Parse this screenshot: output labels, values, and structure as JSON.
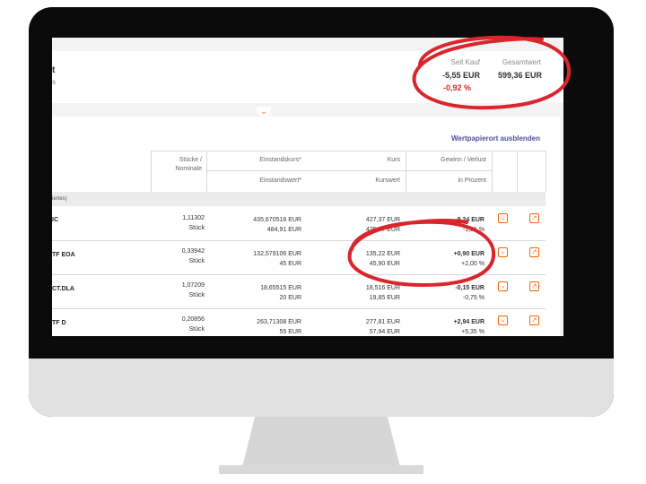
{
  "summary": {
    "title": "t",
    "subtitle": "s",
    "seit_kauf_label": "Seit Kauf",
    "seit_kauf_eur": "-5,55 EUR",
    "seit_kauf_pct": "-0,92 %",
    "gesamtwert_label": "Gesamtwert",
    "gesamtwert_value": "599,36 EUR"
  },
  "panel": {
    "hide_link": "Wertpapierort ausblenden",
    "headers": {
      "stuecke": "Stücke /",
      "nominale": "Nominale",
      "einstandskurs": "Einstandskurs*",
      "einstandswert": "Einstandswert*",
      "kurs": "Kurs",
      "kurswert": "Kurswert",
      "gewinn": "Gewinn / Verlust",
      "prozent": "in Prozent"
    },
    "group_label": "iertes)",
    "rows": [
      {
        "name": "IC",
        "stueck": "1,11302",
        "unit": "Stück",
        "ek": "435,670518 EUR",
        "ew": "484,91 EUR",
        "kurs": "427,37 EUR",
        "kw": "475,67 EUR",
        "gv": "-9,24 EUR",
        "pct": "-1,91 %",
        "dir": "neg"
      },
      {
        "name": "TF EOA",
        "stueck": "0,33942",
        "unit": "Stück",
        "ek": "132,579106 EUR",
        "ew": "45 EUR",
        "kurs": "135,22 EUR",
        "kw": "45,90 EUR",
        "gv": "+0,90 EUR",
        "pct": "+2,00 %",
        "dir": "pos"
      },
      {
        "name": "CT.DLA",
        "stueck": "1,07209",
        "unit": "Stück",
        "ek": "18,65515 EUR",
        "ew": "20 EUR",
        "kurs": "18,516 EUR",
        "kw": "19,85 EUR",
        "gv": "-0,15 EUR",
        "pct": "-0,75 %",
        "dir": "neg"
      },
      {
        "name": "TF D",
        "stueck": "0,20856",
        "unit": "Stück",
        "ek": "263,71308 EUR",
        "ew": "55 EUR",
        "kurs": "277,81 EUR",
        "kw": "57,94 EUR",
        "gv": "+2,94 EUR",
        "pct": "+5,35 %",
        "dir": "pos"
      }
    ]
  },
  "colors": {
    "accent": "#ff6200",
    "negative": "#d42b2b",
    "positive": "#2e9b3a",
    "annotation": "#d9262c"
  }
}
